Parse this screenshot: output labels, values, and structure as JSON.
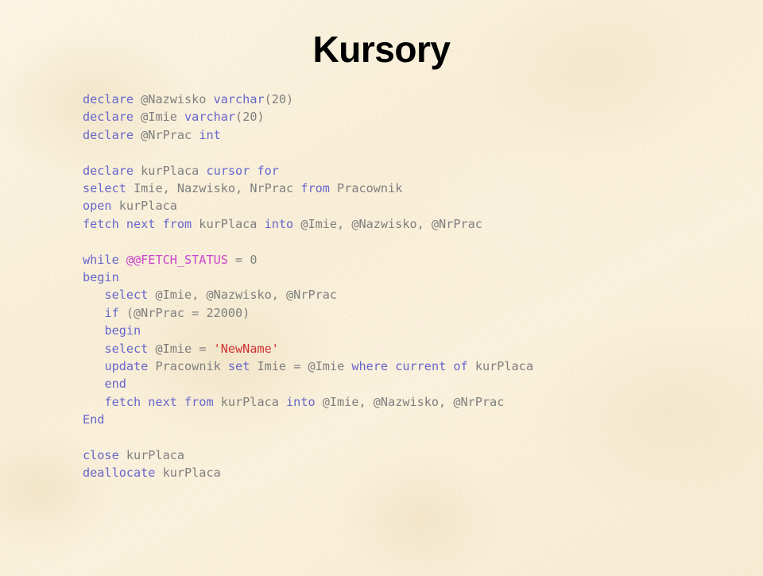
{
  "slide": {
    "title": "Kursory",
    "background_color": "#fbf2de"
  },
  "theme": {
    "keyword_color": "#6666cc",
    "identifier_color": "#7f7f7f",
    "system_variable_color": "#cc44cc",
    "string_color": "#cc3333",
    "title_color": "#000000"
  },
  "code": {
    "language": "T-SQL",
    "lines": [
      {
        "indent": 0,
        "tokens": [
          {
            "t": "kw",
            "v": "declare"
          },
          {
            "t": "id",
            "v": " @Nazwisko "
          },
          {
            "t": "kw",
            "v": "varchar"
          },
          {
            "t": "id",
            "v": "(20)"
          }
        ]
      },
      {
        "indent": 0,
        "tokens": [
          {
            "t": "kw",
            "v": "declare"
          },
          {
            "t": "id",
            "v": " @Imie "
          },
          {
            "t": "kw",
            "v": "varchar"
          },
          {
            "t": "id",
            "v": "(20)"
          }
        ]
      },
      {
        "indent": 0,
        "tokens": [
          {
            "t": "kw",
            "v": "declare"
          },
          {
            "t": "id",
            "v": " @NrPrac "
          },
          {
            "t": "kw",
            "v": "int"
          }
        ]
      },
      {
        "indent": 0,
        "tokens": []
      },
      {
        "indent": 0,
        "tokens": [
          {
            "t": "kw",
            "v": "declare"
          },
          {
            "t": "id",
            "v": " kurPlaca "
          },
          {
            "t": "kw",
            "v": "cursor for"
          }
        ]
      },
      {
        "indent": 0,
        "tokens": [
          {
            "t": "kw",
            "v": "select"
          },
          {
            "t": "id",
            "v": " Imie, Nazwisko, NrPrac "
          },
          {
            "t": "kw",
            "v": "from"
          },
          {
            "t": "id",
            "v": " Pracownik"
          }
        ]
      },
      {
        "indent": 0,
        "tokens": [
          {
            "t": "kw",
            "v": "open"
          },
          {
            "t": "id",
            "v": " kurPlaca"
          }
        ]
      },
      {
        "indent": 0,
        "tokens": [
          {
            "t": "kw",
            "v": "fetch next from"
          },
          {
            "t": "id",
            "v": " kurPlaca "
          },
          {
            "t": "kw",
            "v": "into"
          },
          {
            "t": "id",
            "v": " @Imie, @Nazwisko, @NrPrac"
          }
        ]
      },
      {
        "indent": 0,
        "tokens": []
      },
      {
        "indent": 0,
        "tokens": [
          {
            "t": "kw",
            "v": "while"
          },
          {
            "t": "id",
            "v": " "
          },
          {
            "t": "sys",
            "v": "@@FETCH_STATUS"
          },
          {
            "t": "id",
            "v": " = 0"
          }
        ]
      },
      {
        "indent": 0,
        "tokens": [
          {
            "t": "kw",
            "v": "begin"
          }
        ]
      },
      {
        "indent": 1,
        "tokens": [
          {
            "t": "kw",
            "v": "select"
          },
          {
            "t": "id",
            "v": " @Imie, @Nazwisko, @NrPrac"
          }
        ]
      },
      {
        "indent": 1,
        "tokens": [
          {
            "t": "kw",
            "v": "if"
          },
          {
            "t": "id",
            "v": " (@NrPrac = 22000)"
          }
        ]
      },
      {
        "indent": 1,
        "tokens": [
          {
            "t": "kw",
            "v": "begin"
          }
        ]
      },
      {
        "indent": 1,
        "tokens": [
          {
            "t": "kw",
            "v": "select"
          },
          {
            "t": "id",
            "v": " @Imie = "
          },
          {
            "t": "str",
            "v": "'NewName'"
          }
        ]
      },
      {
        "indent": 1,
        "tokens": [
          {
            "t": "kw",
            "v": "update"
          },
          {
            "t": "id",
            "v": " Pracownik "
          },
          {
            "t": "kw",
            "v": "set"
          },
          {
            "t": "id",
            "v": " Imie = @Imie "
          },
          {
            "t": "kw",
            "v": "where current of"
          },
          {
            "t": "id",
            "v": " kurPlaca"
          }
        ]
      },
      {
        "indent": 1,
        "tokens": [
          {
            "t": "kw",
            "v": "end"
          }
        ]
      },
      {
        "indent": 1,
        "tokens": [
          {
            "t": "kw",
            "v": "fetch next from"
          },
          {
            "t": "id",
            "v": " kurPlaca "
          },
          {
            "t": "kw",
            "v": "into"
          },
          {
            "t": "id",
            "v": " @Imie, @Nazwisko, @NrPrac"
          }
        ]
      },
      {
        "indent": 0,
        "tokens": [
          {
            "t": "kw",
            "v": "End"
          }
        ]
      },
      {
        "indent": 0,
        "tokens": []
      },
      {
        "indent": 0,
        "tokens": [
          {
            "t": "kw",
            "v": "close"
          },
          {
            "t": "id",
            "v": " kurPlaca"
          }
        ]
      },
      {
        "indent": 0,
        "tokens": [
          {
            "t": "kw",
            "v": "deallocate"
          },
          {
            "t": "id",
            "v": " kurPlaca"
          }
        ]
      }
    ]
  }
}
